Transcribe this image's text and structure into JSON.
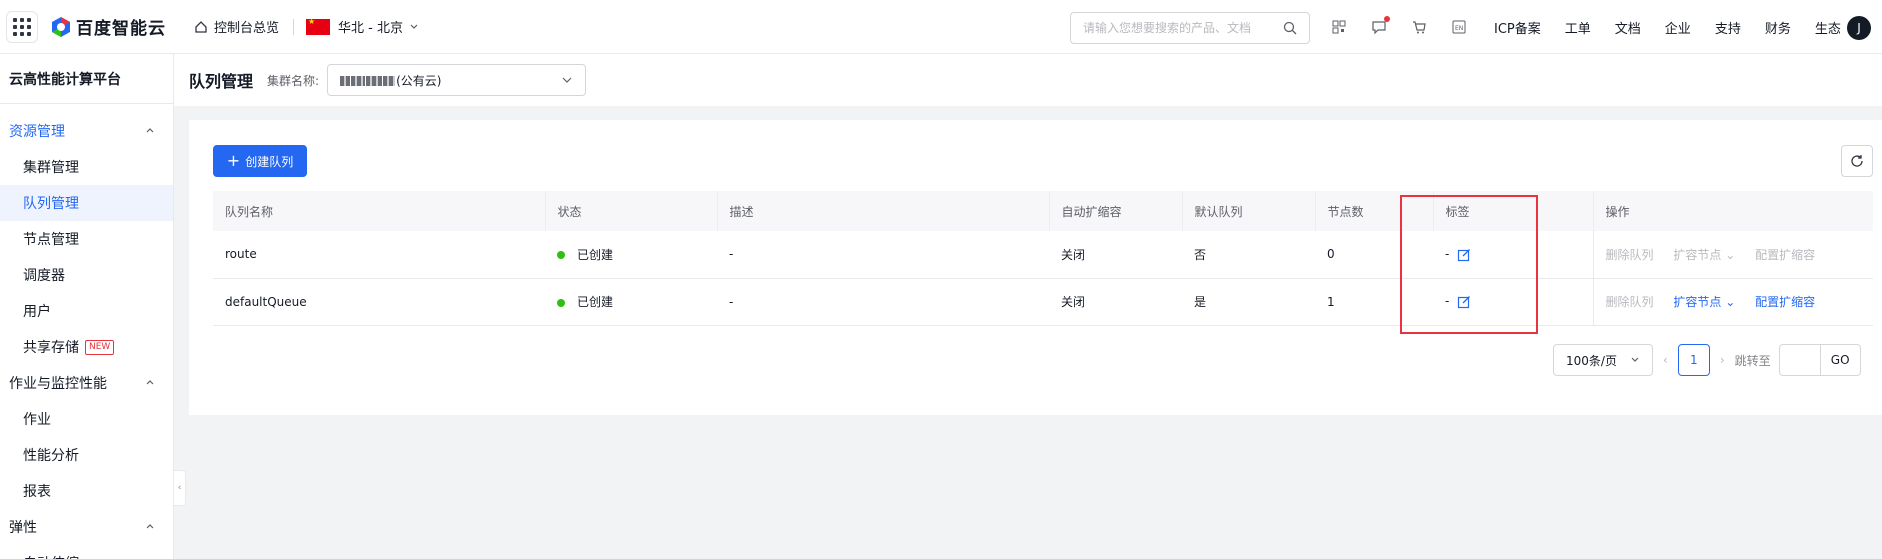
{
  "topbar": {
    "brand": "百度智能云",
    "home_label": "控制台总览",
    "region": "华北 - 北京",
    "search_placeholder": "请输入您想要搜索的产品、文档",
    "nav": [
      "ICP备案",
      "工单",
      "文档",
      "企业",
      "支持",
      "财务",
      "生态"
    ],
    "avatar_letter": "J",
    "icons": [
      "qrcode-icon",
      "message-icon",
      "cart-icon",
      "language-icon"
    ]
  },
  "sidebar": {
    "title": "云高性能计算平台",
    "groups": [
      {
        "label": "资源管理",
        "items": [
          "集群管理",
          "队列管理",
          "节点管理",
          "调度器",
          "用户",
          "共享存储"
        ]
      },
      {
        "label": "作业与监控性能",
        "items": [
          "作业",
          "性能分析",
          "报表"
        ]
      },
      {
        "label": "弹性",
        "items": [
          "自动伸缩"
        ]
      }
    ],
    "new_badge": "NEW"
  },
  "header": {
    "title": "队列管理",
    "cluster_label": "集群名称:",
    "cluster_suffix": "(公有云)"
  },
  "toolbar": {
    "create_label": "创建队列"
  },
  "table": {
    "columns": [
      "队列名称",
      "状态",
      "描述",
      "自动扩缩容",
      "默认队列",
      "节点数",
      "标签",
      "操作"
    ],
    "rows": [
      {
        "name": "route",
        "status": "已创建",
        "desc": "-",
        "autoscale": "关闭",
        "default": "否",
        "nodes": "0",
        "tag": "-",
        "ops": [
          "删除队列",
          "扩容节点",
          "配置扩缩容"
        ]
      },
      {
        "name": "defaultQueue",
        "status": "已创建",
        "desc": "-",
        "autoscale": "关闭",
        "default": "是",
        "nodes": "1",
        "tag": "-",
        "ops": [
          "删除队列",
          "扩容节点",
          "配置扩缩容"
        ]
      }
    ]
  },
  "pagination": {
    "page_size": "100条/页",
    "current_page": "1",
    "goto_label": "跳转至",
    "go_label": "GO"
  },
  "colors": {
    "primary": "#2468f2",
    "success": "#30bf13",
    "highlight": "#e8343e"
  }
}
